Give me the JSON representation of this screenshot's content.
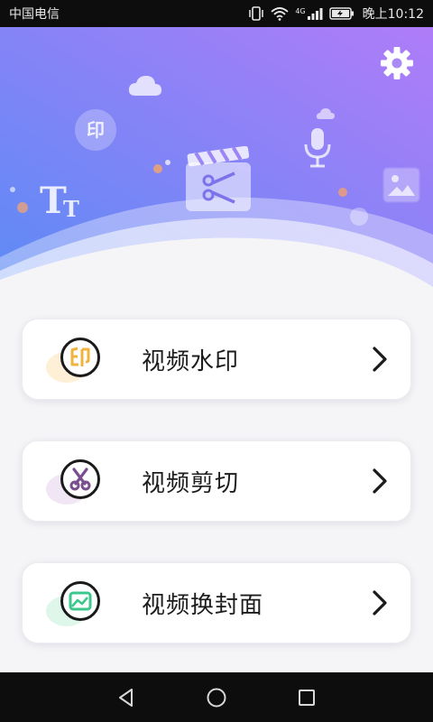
{
  "status_bar": {
    "carrier": "中国电信",
    "network": "4G",
    "time": "晚上10:12"
  },
  "header": {
    "gradient_start": "#5a8bf5",
    "gradient_end": "#b07cf8",
    "icons": [
      "settings-icon",
      "cloud-icon",
      "watermark-badge-icon",
      "text-size-icon",
      "clapperboard-scissors-icon",
      "microphone-icon",
      "image-icon"
    ]
  },
  "menu": {
    "items": [
      {
        "label": "视频水印",
        "icon": "watermark-icon",
        "accent": "#f2b33d",
        "blob": "#fdf0d6"
      },
      {
        "label": "视频剪切",
        "icon": "scissors-icon",
        "accent": "#7b4e8f",
        "blob": "#f1e6f3"
      },
      {
        "label": "视频换封面",
        "icon": "cover-image-icon",
        "accent": "#3cc78d",
        "blob": "#dff6ea"
      }
    ]
  },
  "nav_bar": {
    "buttons": [
      "back-icon",
      "home-icon",
      "recents-icon"
    ]
  }
}
